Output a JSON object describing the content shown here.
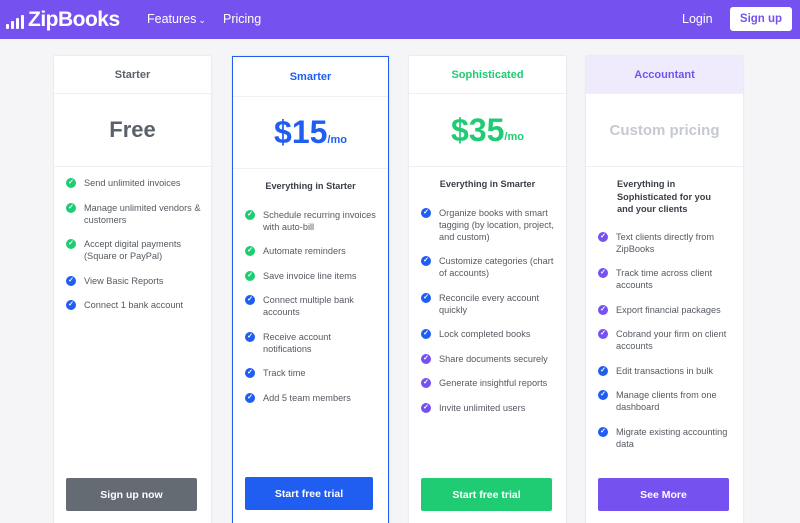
{
  "nav": {
    "brand": "ZipBooks",
    "logo_icon": "bar-chart-icon",
    "links": [
      {
        "label": "Features",
        "icon": "chevron-down-icon"
      },
      {
        "label": "Pricing"
      }
    ],
    "login": "Login",
    "signup": "Sign up"
  },
  "colors": {
    "brand_purple": "#7552f0",
    "blue": "#1f5ef0",
    "green": "#1fcc74",
    "gray_button": "#656b73",
    "accountant_header_bg": "#efebfd"
  },
  "plans": [
    {
      "name": "Starter",
      "price": "Free",
      "subhead": "",
      "features": [
        {
          "text": "Send unlimited invoices",
          "color": "green"
        },
        {
          "text": "Manage unlimited vendors & customers",
          "color": "green"
        },
        {
          "text": "Accept digital payments (Square or PayPal)",
          "color": "green"
        },
        {
          "text": "View Basic Reports",
          "color": "blue"
        },
        {
          "text": "Connect 1 bank account",
          "color": "blue"
        }
      ],
      "cta": "Sign up now"
    },
    {
      "name": "Smarter",
      "price": "$15",
      "period": "/mo",
      "subhead": "Everything in Starter",
      "features": [
        {
          "text": "Schedule recurring invoices with auto-bill",
          "color": "green"
        },
        {
          "text": "Automate reminders",
          "color": "green"
        },
        {
          "text": "Save invoice line items",
          "color": "green"
        },
        {
          "text": "Connect multiple bank accounts",
          "color": "blue"
        },
        {
          "text": "Receive account notifications",
          "color": "blue"
        },
        {
          "text": "Track time",
          "color": "blue"
        },
        {
          "text": "Add 5 team members",
          "color": "blue"
        }
      ],
      "cta": "Start free trial"
    },
    {
      "name": "Sophisticated",
      "price": "$35",
      "period": "/mo",
      "subhead": "Everything in Smarter",
      "features": [
        {
          "text": "Organize books with smart tagging (by location, project, and custom)",
          "color": "blue"
        },
        {
          "text": "Customize categories (chart of accounts)",
          "color": "blue"
        },
        {
          "text": "Reconcile every account quickly",
          "color": "blue"
        },
        {
          "text": "Lock completed books",
          "color": "blue"
        },
        {
          "text": "Share documents securely",
          "color": "purple"
        },
        {
          "text": "Generate insightful reports",
          "color": "purple"
        },
        {
          "text": "Invite unlimited users",
          "color": "purple"
        }
      ],
      "cta": "Start free trial"
    },
    {
      "name": "Accountant",
      "price": "Custom pricing",
      "subhead": "Everything in Sophisticated for you and your clients",
      "features": [
        {
          "text": "Text clients directly from ZipBooks",
          "color": "purple"
        },
        {
          "text": "Track time across client accounts",
          "color": "purple"
        },
        {
          "text": "Export financial packages",
          "color": "purple"
        },
        {
          "text": "Cobrand your firm on client accounts",
          "color": "purple"
        },
        {
          "text": "Edit transactions in bulk",
          "color": "blue"
        },
        {
          "text": "Manage clients from one dashboard",
          "color": "blue"
        },
        {
          "text": "Migrate existing accounting data",
          "color": "blue"
        }
      ],
      "cta": "See More"
    }
  ]
}
